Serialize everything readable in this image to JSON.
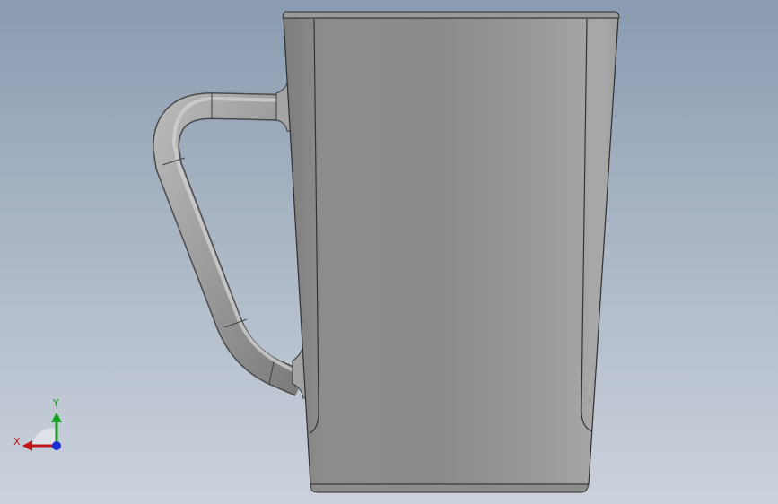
{
  "viewport": {
    "background_top": "#8a9bb1",
    "background_bottom": "#cbd2dc"
  },
  "model": {
    "type": "mug",
    "view": "front"
  },
  "triad": {
    "x_label": "X",
    "y_label": "Y",
    "x_color": "#c0151b",
    "y_color": "#13a11b",
    "z_color": "#1a2fd6"
  }
}
